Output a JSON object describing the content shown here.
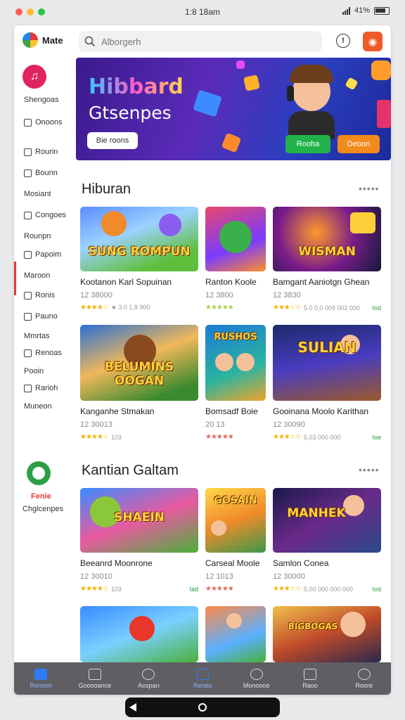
{
  "status": {
    "time": "1:8 18am",
    "battery": "41%"
  },
  "app": {
    "name": "Mate"
  },
  "search": {
    "placeholder": "Alborgerh"
  },
  "sidebar": {
    "heading": "Shengoas",
    "items": [
      {
        "label": "Onoons"
      },
      {
        "label": "Rourin"
      },
      {
        "label": "Bounn"
      },
      {
        "label": "Mosiant"
      },
      {
        "label": "Congoes"
      },
      {
        "label": "Rounpn"
      },
      {
        "label": "Papoim"
      },
      {
        "label": "Maroon"
      },
      {
        "label": "Ronis"
      },
      {
        "label": "Pauno"
      },
      {
        "label": "Mmrtas"
      },
      {
        "label": "Renoas"
      },
      {
        "label": "Pooin"
      },
      {
        "label": "Rarioh"
      },
      {
        "label": "Muneon"
      }
    ],
    "brand_line1": "Fenie",
    "brand_line2": "Chglcenpes"
  },
  "banner": {
    "title": "Hibbard",
    "subtitle": "Gtsenpes",
    "pill": "Bie roons",
    "green_btn": "Rooha",
    "orange_btn": "Deoon"
  },
  "sections": [
    {
      "title": "Hiburan",
      "more": "•••••",
      "cards": [
        {
          "thumb": "SUNG ROMPUN",
          "title": "Kootanon Karl Sopuinan",
          "sub": "12 38000",
          "meta": "★ 3.0 1,8 900",
          "get": ""
        },
        {
          "thumb": "",
          "title": "Ranton Koole",
          "sub": "12 3800",
          "meta": "",
          "get": ""
        },
        {
          "thumb": "WISMAN",
          "title": "Bamgant Aaniotgn Ghean",
          "sub": "12 3830",
          "meta": "5.0 0,0 009 002 000",
          "get": "Iod"
        },
        {
          "thumb": "BELUMINS OOGAN",
          "title": "Kanganhe Stmakan",
          "sub": "12 30013",
          "meta": "103",
          "get": ""
        },
        {
          "thumb": "RUSHOS",
          "title": "Bomsadf Boie",
          "sub": "20 13",
          "meta": "",
          "get": ""
        },
        {
          "thumb": "SULIAN",
          "title": "Gooinana Moolo Karithan",
          "sub": "12 30090",
          "meta": "5,03 000 000",
          "get": "Ioe"
        }
      ]
    },
    {
      "title": "Kantian Galtam",
      "more": "•••••",
      "cards": [
        {
          "thumb": "SHAEIN",
          "title": "Beeanrd Moonrone",
          "sub": "12 30010",
          "meta": "103",
          "get": "Iad"
        },
        {
          "thumb": "GOSAIN",
          "title": "Carseal Moole",
          "sub": "12 1013",
          "meta": "",
          "get": ""
        },
        {
          "thumb": "MANHEK",
          "title": "Samlon Conea",
          "sub": "12 30000",
          "meta": "5,00 000 000 000",
          "get": "Iod"
        },
        {
          "thumb": "",
          "title": "",
          "sub": "",
          "meta": "",
          "get": ""
        },
        {
          "thumb": "",
          "title": "",
          "sub": "",
          "meta": "",
          "get": ""
        },
        {
          "thumb": "BIGBOGAS",
          "title": "",
          "sub": "",
          "meta": "",
          "get": ""
        }
      ]
    }
  ],
  "bottom_nav": [
    {
      "label": "Ronnon",
      "active": true
    },
    {
      "label": "Gooooance"
    },
    {
      "label": "Aospan"
    },
    {
      "label": "Rerats"
    },
    {
      "label": "Monoooe"
    },
    {
      "label": "Raoo"
    },
    {
      "label": "Roore"
    }
  ]
}
